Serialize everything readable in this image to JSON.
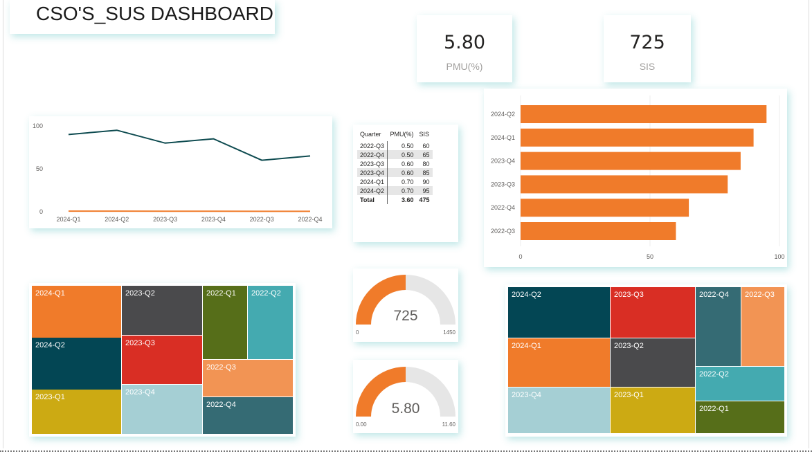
{
  "header": {
    "title": "CSO'S_SUS DASHBOARD"
  },
  "kpis": {
    "pmu": {
      "value": "5.80",
      "label": "PMU(%)"
    },
    "sis": {
      "value": "725",
      "label": "SIS"
    }
  },
  "line_chart": {
    "type": "line",
    "y_ticks": [
      "100",
      "50",
      "0"
    ],
    "ylim": [
      0,
      100
    ],
    "categories": [
      "2024-Q1",
      "2024-Q2",
      "2023-Q3",
      "2023-Q4",
      "2022-Q3",
      "2022-Q4"
    ],
    "series": [
      {
        "values": [
          90,
          95,
          80,
          85,
          60,
          65
        ],
        "color": "#0e4b50"
      },
      {
        "values": [
          0.7,
          0.7,
          0.6,
          0.6,
          0.5,
          0.5
        ],
        "color": "#f07b2a"
      }
    ]
  },
  "table": {
    "headers": [
      "Quarter",
      "PMU(%)",
      "SIS"
    ],
    "rows": [
      [
        "2022-Q3",
        "0.50",
        "60"
      ],
      [
        "2022-Q4",
        "0.50",
        "65"
      ],
      [
        "2023-Q3",
        "0.60",
        "80"
      ],
      [
        "2023-Q4",
        "0.60",
        "85"
      ],
      [
        "2024-Q1",
        "0.70",
        "90"
      ],
      [
        "2024-Q2",
        "0.70",
        "95"
      ]
    ],
    "total": [
      "Total",
      "3.60",
      "475"
    ]
  },
  "bar_chart": {
    "type": "bar",
    "orientation": "horizontal",
    "color": "#f07b2a",
    "categories": [
      "2024-Q2",
      "2024-Q1",
      "2023-Q4",
      "2023-Q3",
      "2022-Q4",
      "2022-Q3"
    ],
    "values": [
      95,
      90,
      85,
      80,
      65,
      60
    ],
    "x_ticks": [
      "0",
      "50",
      "100"
    ],
    "xlim": [
      0,
      100
    ]
  },
  "gauge_sis": {
    "value": 725,
    "value_label": "725",
    "min_label": "0",
    "max_label": "1450",
    "min": 0,
    "max": 1450,
    "color": "#f07b2a",
    "track": "#e6e6e6"
  },
  "gauge_pmu": {
    "value": 5.8,
    "value_label": "5.80",
    "min_label": "0.00",
    "max_label": "11.60",
    "min": 0,
    "max": 11.6,
    "color": "#f07b2a",
    "track": "#e6e6e6"
  },
  "treemap_left": {
    "tiles": [
      {
        "label": "2024-Q1",
        "color": "#f07b2a"
      },
      {
        "label": "2024-Q2",
        "color": "#034654"
      },
      {
        "label": "2023-Q1",
        "color": "#ccaa13"
      },
      {
        "label": "2023-Q2",
        "color": "#4a4a4c"
      },
      {
        "label": "2023-Q3",
        "color": "#d92e24"
      },
      {
        "label": "2023-Q4",
        "color": "#a5cfd4"
      },
      {
        "label": "2022-Q1",
        "color": "#566e19"
      },
      {
        "label": "2022-Q2",
        "color": "#44aab0"
      },
      {
        "label": "2022-Q3",
        "color": "#f29454"
      },
      {
        "label": "2022-Q4",
        "color": "#356b74"
      }
    ]
  },
  "treemap_right": {
    "tiles": [
      {
        "label": "2024-Q2",
        "color": "#034654"
      },
      {
        "label": "2024-Q1",
        "color": "#f07b2a"
      },
      {
        "label": "2023-Q4",
        "color": "#a5cfd4"
      },
      {
        "label": "2023-Q3",
        "color": "#d92e24"
      },
      {
        "label": "2023-Q2",
        "color": "#4a4a4c"
      },
      {
        "label": "2023-Q1",
        "color": "#ccaa13"
      },
      {
        "label": "2022-Q4",
        "color": "#356b74"
      },
      {
        "label": "2022-Q3",
        "color": "#f29454"
      },
      {
        "label": "2022-Q2",
        "color": "#44aab0"
      },
      {
        "label": "2022-Q1",
        "color": "#566e19"
      }
    ]
  }
}
